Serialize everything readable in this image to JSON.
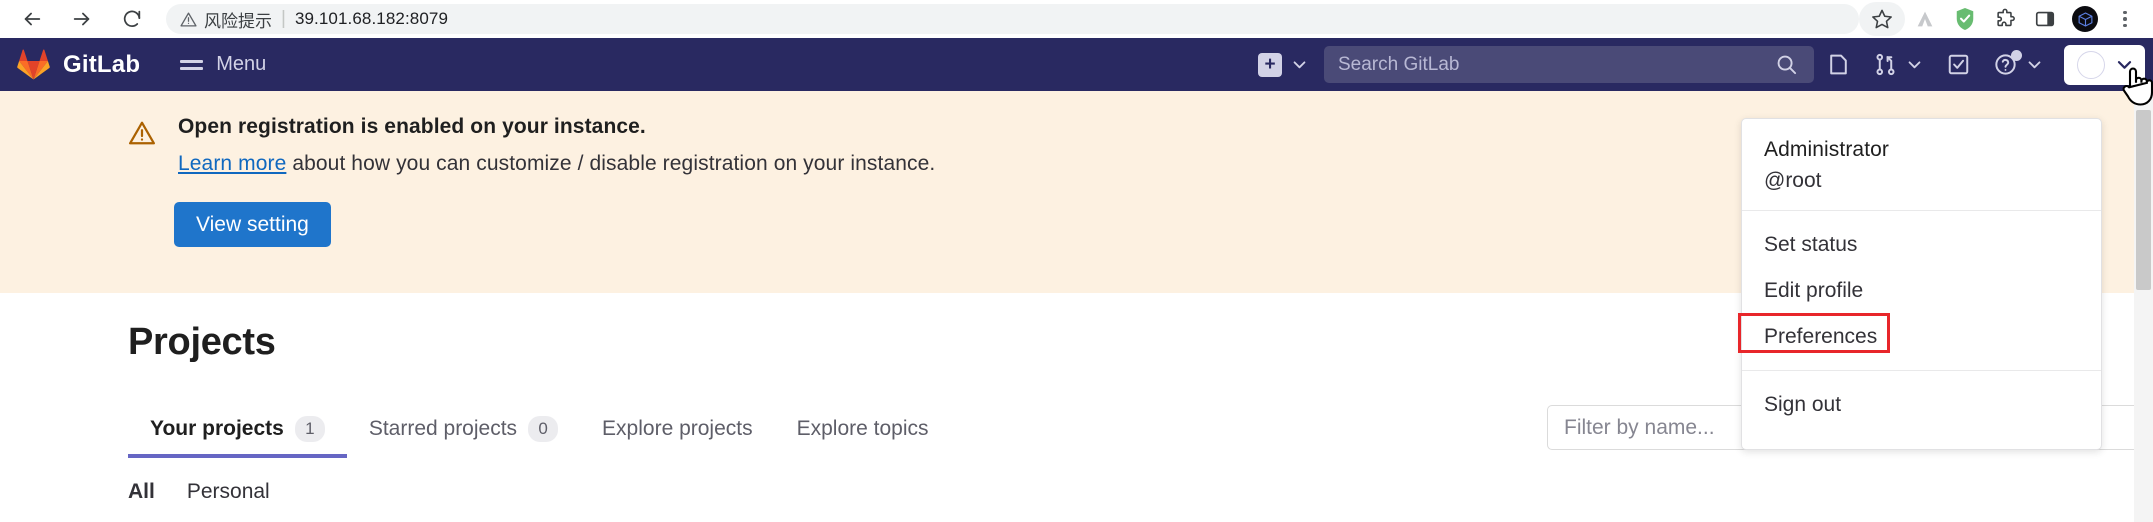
{
  "browser": {
    "back_icon": "back-arrow-icon",
    "forward_icon": "forward-arrow-icon",
    "reload_icon": "reload-icon",
    "security_warning": "风险提示",
    "url": "39.101.68.182:8079",
    "bookmark_icon": "star-icon",
    "extensions": [
      "mountain-icon",
      "adguard-shield-icon",
      "puzzle-extensions-icon",
      "side-panel-icon",
      "profile-avatar-icon",
      "browser-menu-icon"
    ]
  },
  "navbar": {
    "brand": "GitLab",
    "brand_logo_icon": "gitlab-tanuki-icon",
    "menu_label": "Menu",
    "menu_icon": "hamburger-icon",
    "new_icon": "plus-square-icon",
    "new_chevron_icon": "chevron-down-icon",
    "search_placeholder": "Search GitLab",
    "search_icon": "search-icon",
    "issues_icon": "issues-icon",
    "merge_requests_icon": "merge-request-icon",
    "merge_chevron_icon": "chevron-down-icon",
    "todos_icon": "todo-checkbox-icon",
    "help_icon": "question-circle-icon",
    "help_chevron_icon": "chevron-down-icon",
    "avatar_icon": "user-avatar-icon",
    "avatar_chevron_icon": "chevron-down-icon",
    "cursor_icon": "hand-pointer-cursor"
  },
  "alert": {
    "warning_icon": "warning-triangle-icon",
    "title": "Open registration is enabled on your instance.",
    "link_text": "Learn more",
    "description": " about how you can customize / disable registration on your instance.",
    "button_label": "View setting",
    "background_color": "#fdf1e1",
    "button_color": "#1f75cb"
  },
  "main": {
    "page_title": "Projects",
    "tabs": [
      {
        "label": "Your projects",
        "count": "1",
        "active": true
      },
      {
        "label": "Starred projects",
        "count": "0",
        "active": false
      },
      {
        "label": "Explore projects",
        "count": "",
        "active": false
      },
      {
        "label": "Explore topics",
        "count": "",
        "active": false
      }
    ],
    "filter_placeholder": "Filter by name...",
    "subtabs": [
      {
        "label": "All",
        "active": true
      },
      {
        "label": "Personal",
        "active": false
      }
    ],
    "active_tab_color": "#6666c4"
  },
  "user_dropdown": {
    "name": "Administrator",
    "username": "@root",
    "items": [
      {
        "label": "Set status",
        "highlighted": false
      },
      {
        "label": "Edit profile",
        "highlighted": false
      },
      {
        "label": "Preferences",
        "highlighted": true
      }
    ],
    "sign_out_label": "Sign out",
    "highlight_color": "#e8262a"
  }
}
